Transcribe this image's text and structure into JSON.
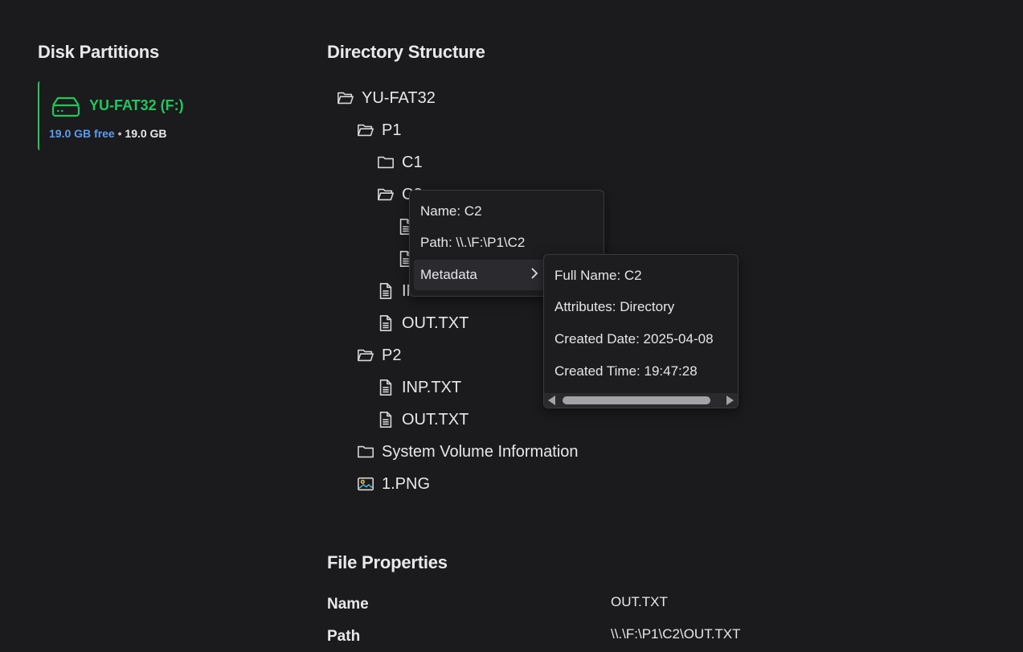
{
  "disk_partitions": {
    "title": "Disk Partitions",
    "items": [
      {
        "name": "YU-FAT32 (F:)",
        "free": "19.0 GB free",
        "separator": "•",
        "total": "19.0 GB",
        "accent": "#22c55e",
        "icon": "hard-drive-icon"
      }
    ]
  },
  "directory": {
    "title": "Directory Structure",
    "nodes": [
      {
        "label": "YU-FAT32",
        "icon": "folder-open-icon"
      },
      {
        "label": "P1",
        "icon": "folder-open-icon"
      },
      {
        "label": "C1",
        "icon": "folder-icon"
      },
      {
        "label": "C2",
        "icon": "folder-open-icon"
      },
      {
        "label": "",
        "icon": "file-icon"
      },
      {
        "label": "",
        "icon": "file-icon"
      },
      {
        "label": "INP.TXT",
        "icon": "file-icon"
      },
      {
        "label": "OUT.TXT",
        "icon": "file-icon"
      },
      {
        "label": "P2",
        "icon": "folder-open-icon"
      },
      {
        "label": "INP.TXT",
        "icon": "file-icon"
      },
      {
        "label": "OUT.TXT",
        "icon": "file-icon"
      },
      {
        "label": "System Volume Information",
        "icon": "folder-icon"
      },
      {
        "label": "1.PNG",
        "icon": "image-icon"
      }
    ]
  },
  "context_menu": {
    "items": [
      "Name: C2",
      "Path: \\\\.\\F:\\P1\\C2",
      "Metadata"
    ]
  },
  "metadata_submenu": {
    "items": [
      "Full Name: C2",
      "Attributes: Directory",
      "Created Date: 2025-04-08",
      "Created Time: 19:47:28"
    ]
  },
  "file_properties": {
    "title": "File Properties",
    "rows": [
      {
        "key": "Name",
        "value": "OUT.TXT"
      },
      {
        "key": "Path",
        "value": "\\\\.\\F:\\P1\\C2\\OUT.TXT"
      }
    ]
  }
}
